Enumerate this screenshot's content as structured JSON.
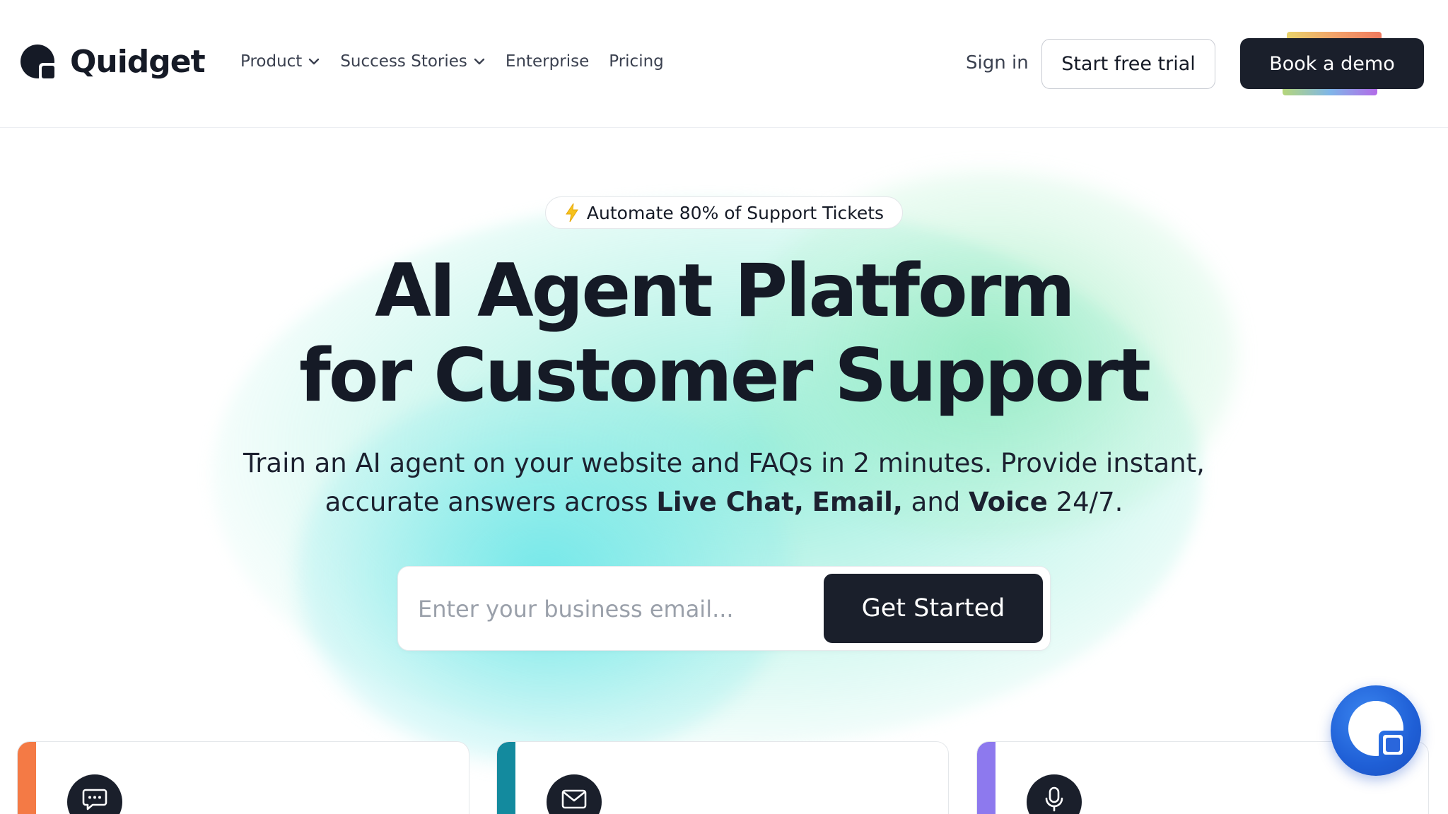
{
  "brand": {
    "name": "Quidget"
  },
  "nav": {
    "items": [
      {
        "label": "Product",
        "has_dropdown": true
      },
      {
        "label": "Success Stories",
        "has_dropdown": true
      },
      {
        "label": "Enterprise",
        "has_dropdown": false
      },
      {
        "label": "Pricing",
        "has_dropdown": false
      }
    ],
    "sign_in": "Sign in",
    "start_trial": "Start free trial",
    "book_demo": "Book a demo"
  },
  "hero": {
    "badge": "Automate 80% of Support Tickets",
    "badge_icon": "lightning-bolt-icon",
    "title_line1": "AI Agent Platform",
    "title_line2": "for Customer Support",
    "subtitle_line1": "Train an AI agent on your website and FAQs in 2 minutes. Provide instant,",
    "subtitle_line2_prefix": "accurate answers across ",
    "subtitle_live_chat": "Live Chat,",
    "subtitle_email": "Email,",
    "subtitle_and": "and",
    "subtitle_voice": "Voice",
    "subtitle_suffix": "24/7.",
    "email_placeholder": "Enter your business email...",
    "cta": "Get Started"
  },
  "cards": [
    {
      "icon": "chat-bubble-icon",
      "stripe_color": "#f47a45"
    },
    {
      "icon": "mail-icon",
      "stripe_color": "#138a9e"
    },
    {
      "icon": "microphone-icon",
      "stripe_color": "#8d79ee"
    }
  ],
  "colors": {
    "primary_dark": "#1a1f2b",
    "launcher_blue": "#1f5fd6",
    "text": "#151a26"
  }
}
